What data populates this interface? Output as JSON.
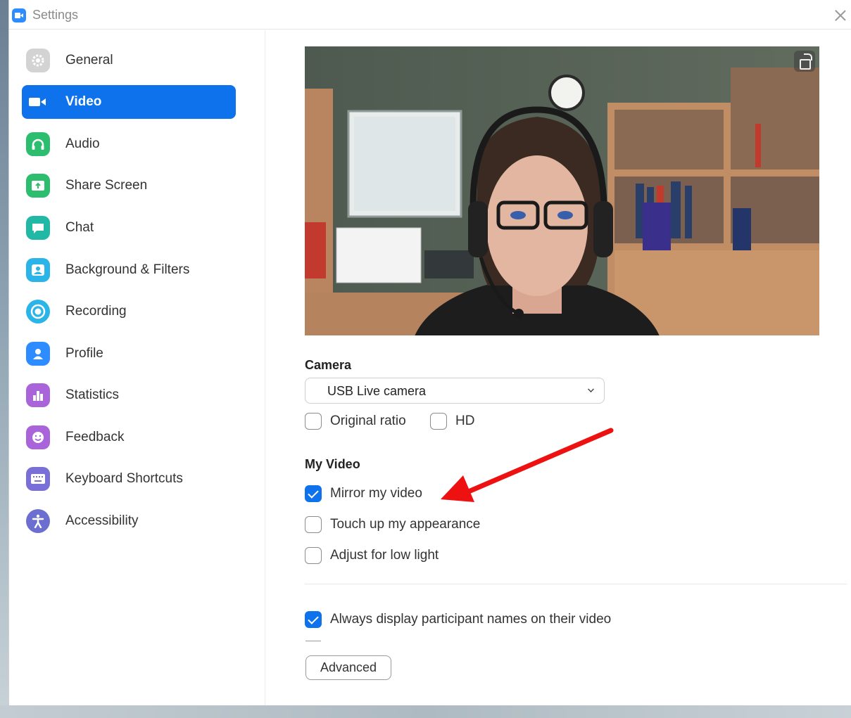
{
  "window": {
    "title": "Settings"
  },
  "sidebar": {
    "items": [
      {
        "label": "General",
        "icon": "gear-icon",
        "color": "#cfcfcf",
        "active": false
      },
      {
        "label": "Video",
        "icon": "video-camera-icon",
        "color": "#0e72ed",
        "active": true
      },
      {
        "label": "Audio",
        "icon": "headphones-icon",
        "color": "#2dbd6e",
        "active": false
      },
      {
        "label": "Share Screen",
        "icon": "share-screen-icon",
        "color": "#2dbd6e",
        "active": false
      },
      {
        "label": "Chat",
        "icon": "chat-bubble-icon",
        "color": "#22b8a6",
        "active": false
      },
      {
        "label": "Background & Filters",
        "icon": "background-icon",
        "color": "#2ab4e8",
        "active": false
      },
      {
        "label": "Recording",
        "icon": "record-icon",
        "color": "#2ab4e8",
        "active": false
      },
      {
        "label": "Profile",
        "icon": "person-icon",
        "color": "#2d8cff",
        "active": false
      },
      {
        "label": "Statistics",
        "icon": "bar-chart-icon",
        "color": "#a864d8",
        "active": false
      },
      {
        "label": "Feedback",
        "icon": "smiley-icon",
        "color": "#a864d8",
        "active": false
      },
      {
        "label": "Keyboard Shortcuts",
        "icon": "keyboard-icon",
        "color": "#7a6fd6",
        "active": false
      },
      {
        "label": "Accessibility",
        "icon": "accessibility-icon",
        "color": "#6c6fd0",
        "active": false
      }
    ]
  },
  "video": {
    "camera_section": "Camera",
    "camera_select": "USB  Live camera",
    "original_ratio": {
      "label": "Original ratio",
      "checked": false
    },
    "hd": {
      "label": "HD",
      "checked": false
    },
    "my_video_section": "My Video",
    "mirror": {
      "label": "Mirror my video",
      "checked": true
    },
    "touch_up": {
      "label": "Touch up my appearance",
      "checked": false
    },
    "low_light": {
      "label": "Adjust for low light",
      "checked": false
    },
    "display_names": {
      "label": "Always display participant names on their video",
      "checked": true
    },
    "advanced_button": "Advanced"
  },
  "annotation": {
    "arrow_color": "#ee1111"
  }
}
